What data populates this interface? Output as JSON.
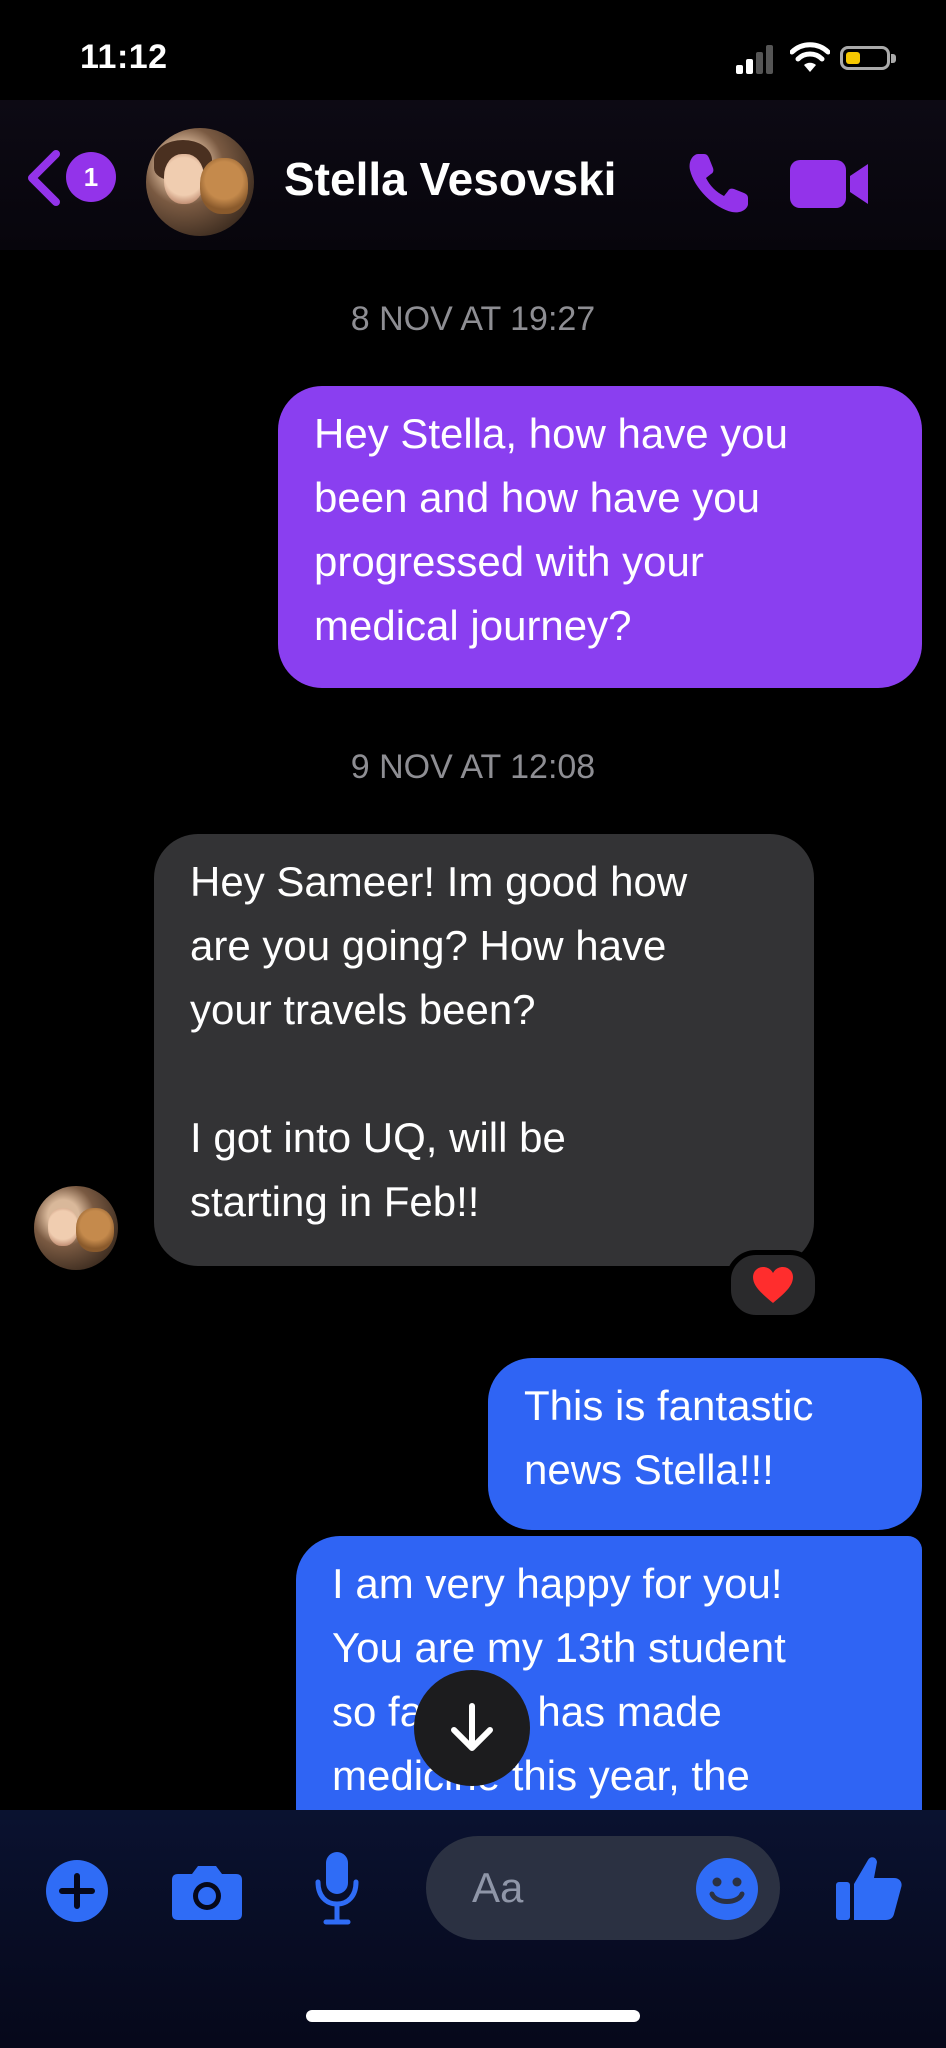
{
  "status_bar": {
    "time": "11:12"
  },
  "header": {
    "unread_count": "1",
    "contact_name": "Stella Vesovski"
  },
  "messages": [
    {
      "type": "timestamp",
      "text": "8 NOV AT 19:27"
    },
    {
      "type": "sent",
      "color": "#8a3ff0",
      "lines": [
        "Hey Stella, how have you",
        "been and how have you",
        "progressed with your",
        "medical journey?"
      ]
    },
    {
      "type": "timestamp",
      "text": "9 NOV AT 12:08"
    },
    {
      "type": "received",
      "color": "#333335",
      "lines": [
        "Hey Sameer! Im good how",
        "are you going? How have",
        "your travels been?",
        "",
        "I got into UQ, will be",
        "starting in Feb!!"
      ],
      "reaction": "heart"
    },
    {
      "type": "sent",
      "color": "#2f64f4",
      "lines": [
        "This is fantastic",
        "news Stella!!!"
      ]
    },
    {
      "type": "sent",
      "color": "#2f64f4",
      "lines": [
        "I am very happy for you!",
        "You are my 13th student",
        "so far who has made",
        "medicine this year, the"
      ]
    }
  ],
  "composer": {
    "placeholder": "Aa"
  },
  "icons": [
    "back-chevron-icon",
    "phone-icon",
    "video-camera-icon",
    "plus-icon",
    "camera-icon",
    "microphone-icon",
    "emoji-icon",
    "thumbs-up-icon",
    "arrow-down-icon",
    "heart-icon"
  ]
}
